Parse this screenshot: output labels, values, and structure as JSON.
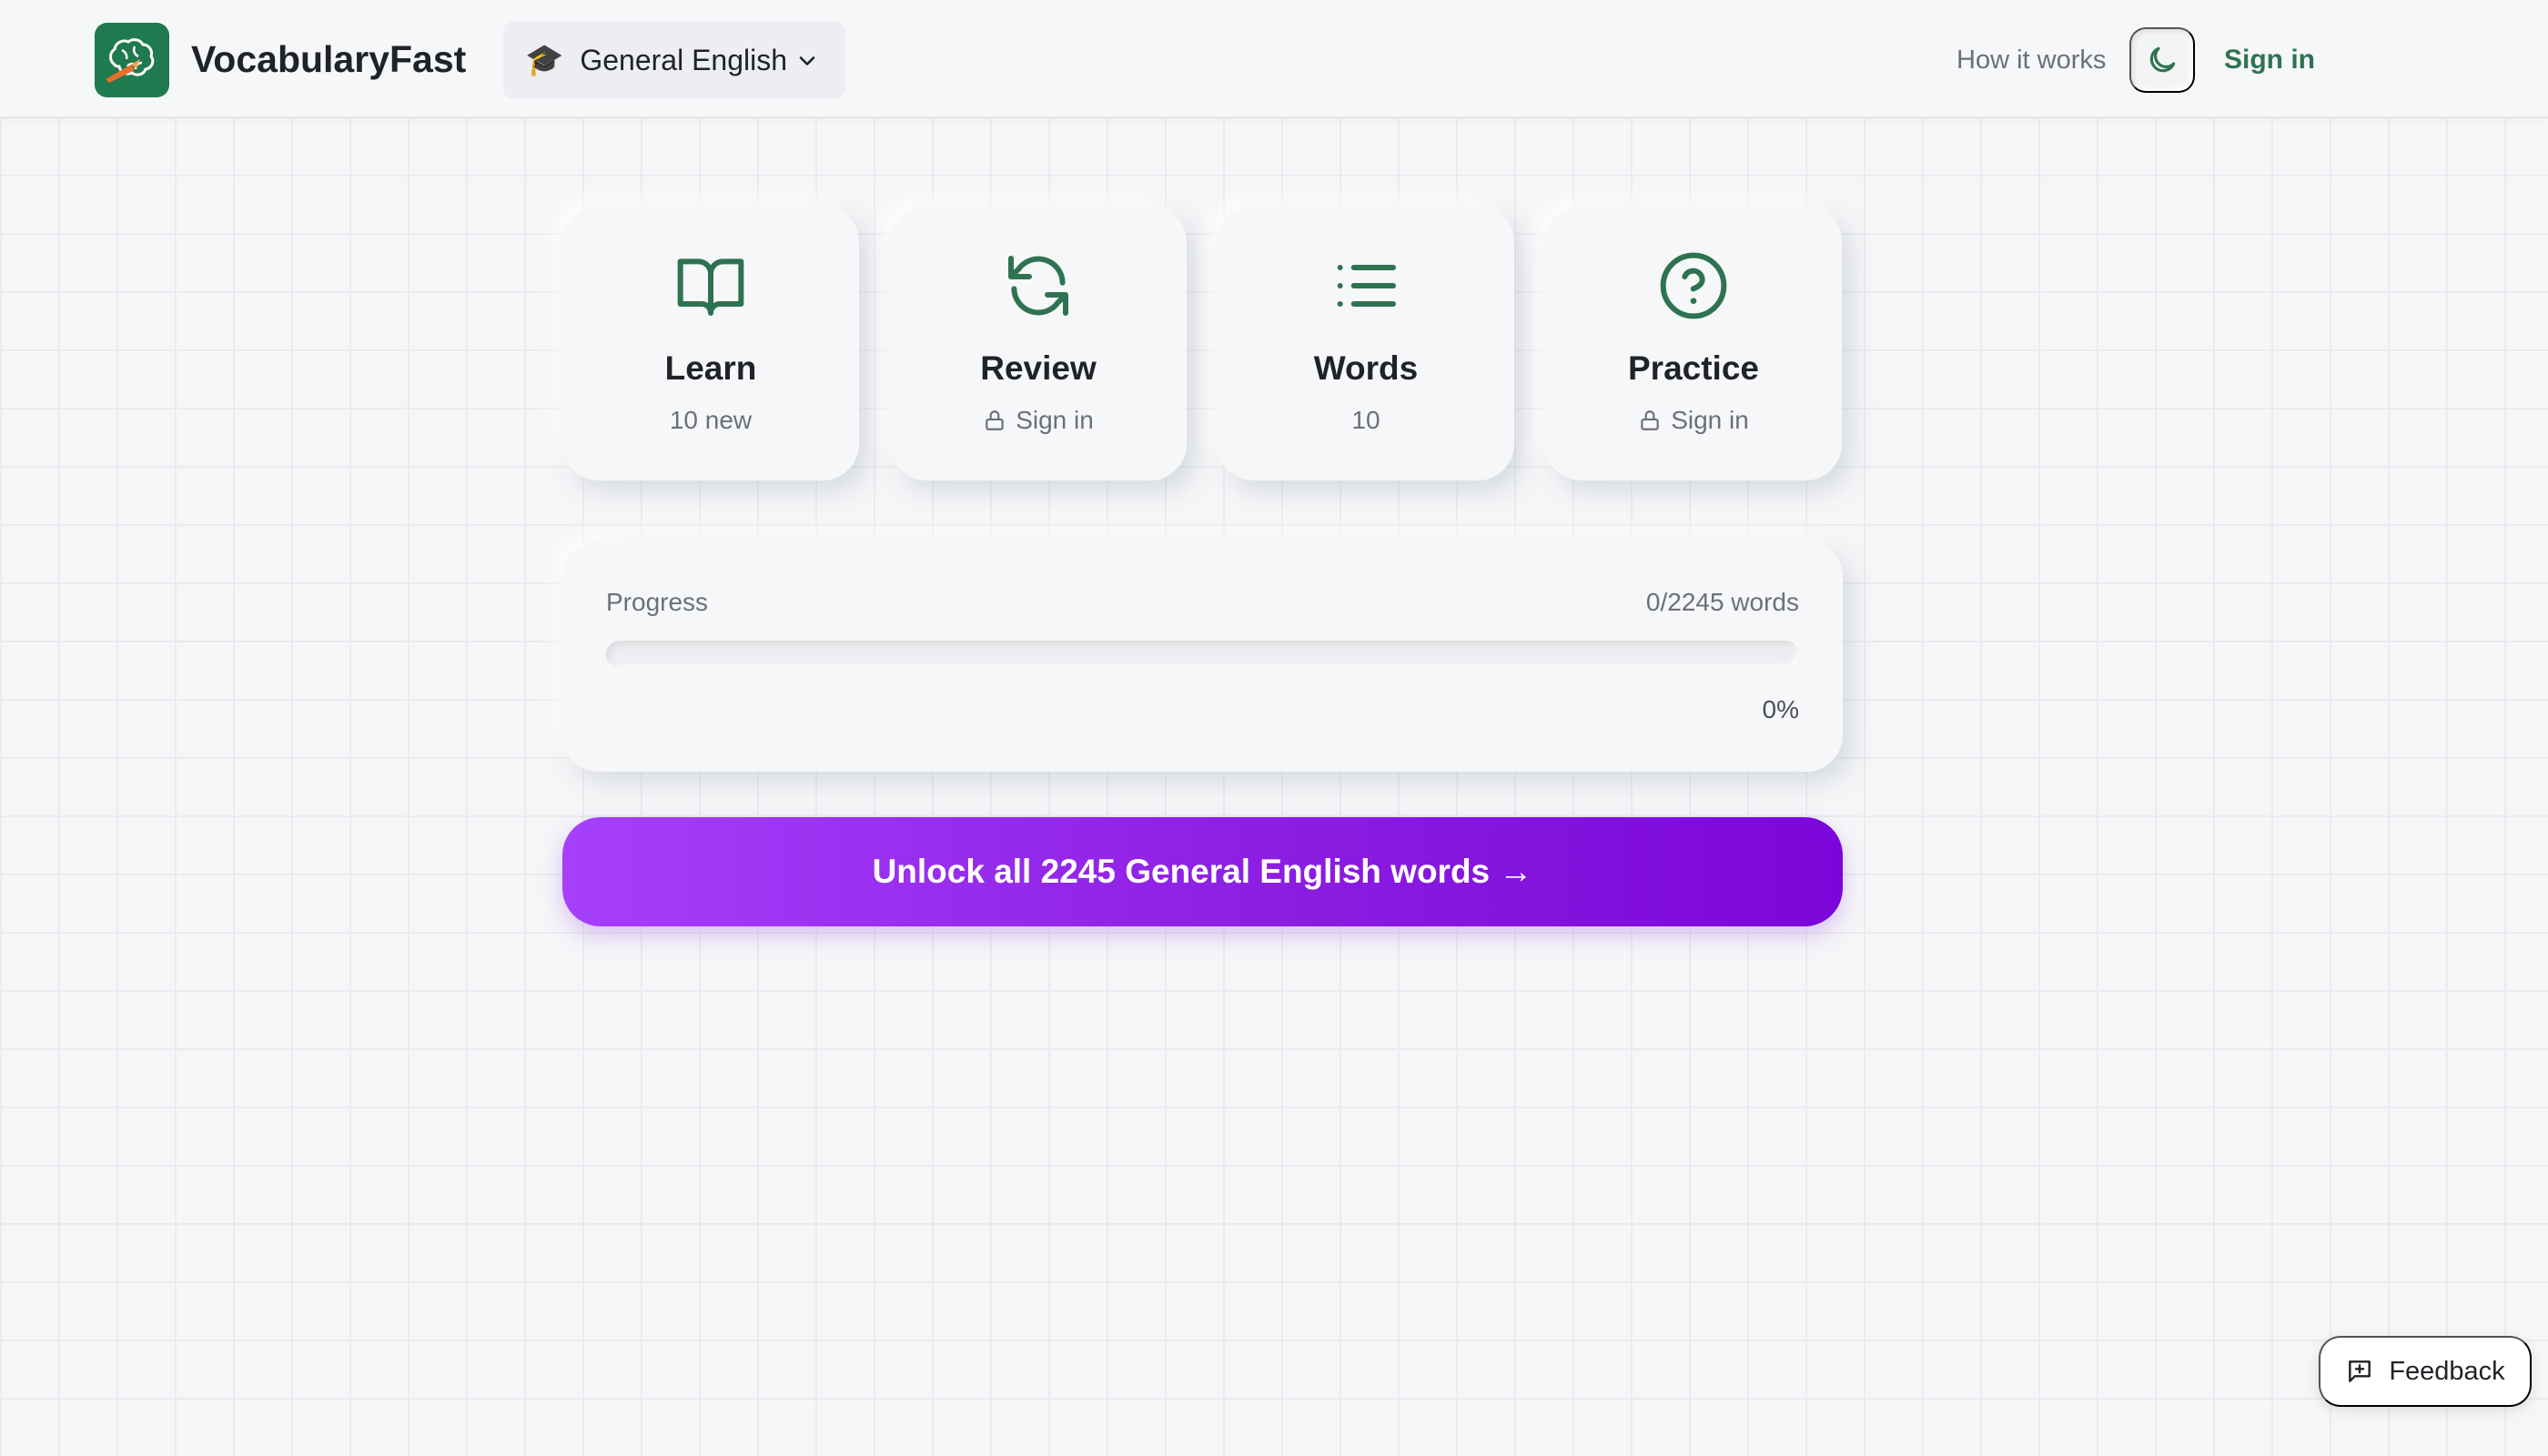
{
  "header": {
    "brand": "VocabularyFast",
    "topic": {
      "emoji": "🎓",
      "label": "General English"
    },
    "how_it_works": "How it works",
    "sign_in": "Sign in"
  },
  "cards": [
    {
      "title": "Learn",
      "subtitle": "10 new",
      "locked": false,
      "icon": "book-open-icon"
    },
    {
      "title": "Review",
      "subtitle": "Sign in",
      "locked": true,
      "icon": "refresh-icon"
    },
    {
      "title": "Words",
      "subtitle": "10",
      "locked": false,
      "icon": "list-icon"
    },
    {
      "title": "Practice",
      "subtitle": "Sign in",
      "locked": true,
      "icon": "help-circle-icon"
    }
  ],
  "progress": {
    "label": "Progress",
    "count": "0/2245 words",
    "percent_text": "0%",
    "fraction": 0
  },
  "cta": {
    "label": "Unlock all 2245 General English words →"
  },
  "feedback": {
    "label": "Feedback"
  },
  "colors": {
    "accent_green": "#2e7351",
    "cta_start": "#a63ffb",
    "cta_end": "#7b06d9"
  }
}
